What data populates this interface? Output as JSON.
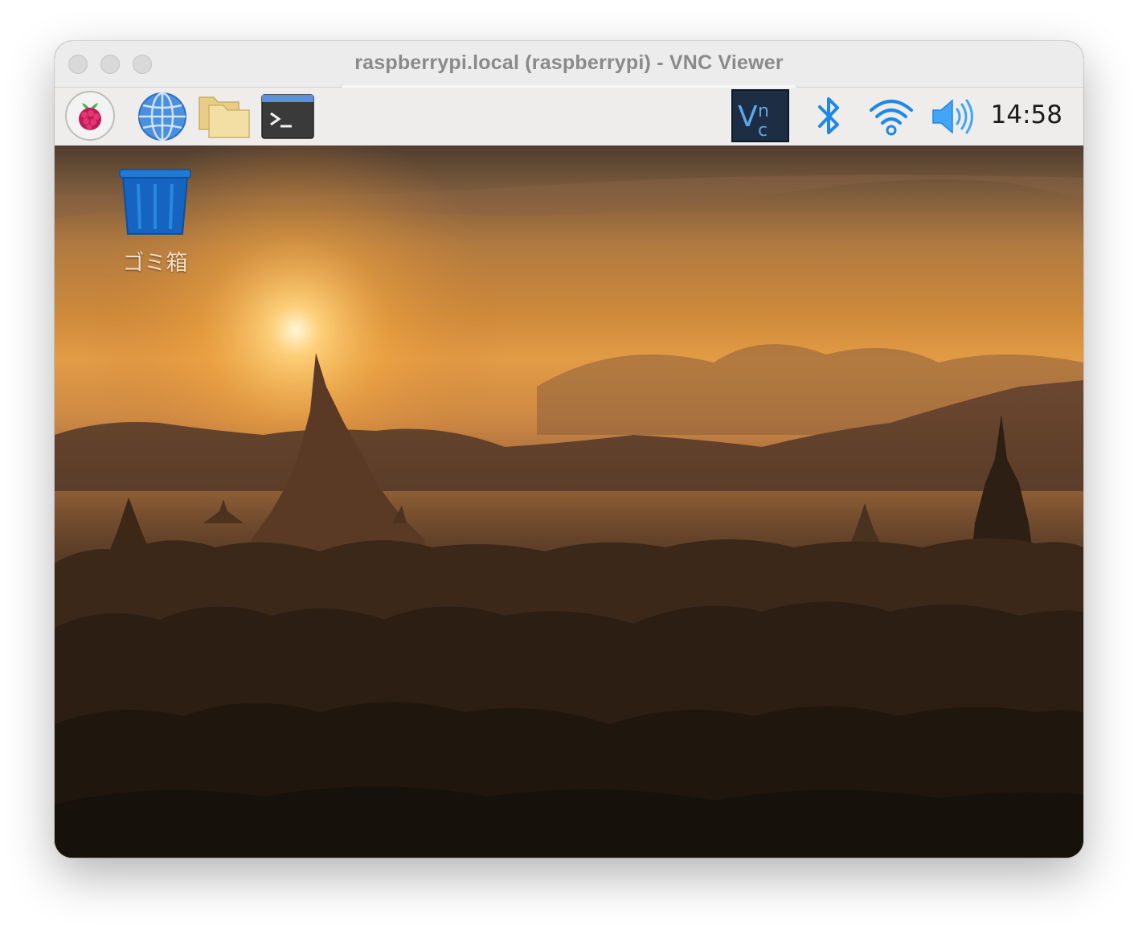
{
  "window": {
    "title": "raspberrypi.local (raspberrypi) - VNC Viewer"
  },
  "taskbar": {
    "launchers": [
      {
        "name": "raspberry-menu",
        "icon": "raspberry-pi-icon"
      },
      {
        "name": "web-browser",
        "icon": "globe-icon"
      },
      {
        "name": "file-manager",
        "icon": "folder-icon"
      },
      {
        "name": "terminal",
        "icon": "terminal-icon"
      }
    ],
    "tray": {
      "vnc_icon": "vnc-icon",
      "bluetooth_icon": "bluetooth-icon",
      "wifi_icon": "wifi-icon",
      "volume_icon": "volume-icon",
      "clock": "14:58"
    }
  },
  "desktop": {
    "trash": {
      "label": "ゴミ箱",
      "icon": "trash-bin-icon"
    },
    "wallpaper": "sunset-pagoda-landscape"
  },
  "colors": {
    "titlebar_bg": "#ececec",
    "title_text": "#8a8a8a",
    "taskbar_bg": "#eeedeb",
    "accent_blue": "#1e88e5",
    "vnc_bg": "#1d2d44",
    "trash_blue": "#1565c0"
  }
}
